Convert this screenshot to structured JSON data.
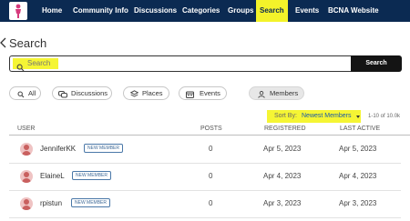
{
  "nav": {
    "items": [
      {
        "label": "Home",
        "active": false
      },
      {
        "label": "Community Info",
        "active": false
      },
      {
        "label": "Discussions",
        "active": false
      },
      {
        "label": "Categories",
        "active": false
      },
      {
        "label": "Groups",
        "active": false
      },
      {
        "label": "Search",
        "active": true
      },
      {
        "label": "Events",
        "active": false
      },
      {
        "label": "BCNA Website",
        "active": false
      }
    ]
  },
  "page": {
    "title": "Search"
  },
  "search": {
    "placeholder": "Search",
    "button_label": "Search"
  },
  "filters": [
    {
      "label": "All",
      "icon": "search-icon",
      "active": false
    },
    {
      "label": "Discussions",
      "icon": "chat-bubbles-icon",
      "active": false
    },
    {
      "label": "Places",
      "icon": "layers-icon",
      "active": false
    },
    {
      "label": "Events",
      "icon": "calendar-icon",
      "active": false
    },
    {
      "label": "Members",
      "icon": "person-icon",
      "active": true
    }
  ],
  "sort": {
    "label": "Sort By:",
    "value": "Newest Members",
    "page_info": "1-10 of 10.0k"
  },
  "table": {
    "headers": {
      "user": "USER",
      "posts": "POSTS",
      "registered": "REGISTERED",
      "last_active": "LAST ACTIVE"
    },
    "rows": [
      {
        "name": "JenniferKK",
        "badge": "NEW MEMBER",
        "posts": "0",
        "registered": "Apr 5, 2023",
        "last_active": "Apr 5, 2023"
      },
      {
        "name": "ElaineL",
        "badge": "NEW MEMBER",
        "posts": "0",
        "registered": "Apr 4, 2023",
        "last_active": "Apr 4, 2023"
      },
      {
        "name": "rpistun",
        "badge": "NEW MEMBER",
        "posts": "0",
        "registered": "Apr 3, 2023",
        "last_active": "Apr 3, 2023"
      }
    ]
  },
  "colors": {
    "nav_bg": "#0b2a52",
    "highlight": "#f5f534",
    "link": "#1a5aa8",
    "avatar": "#c9605f"
  }
}
